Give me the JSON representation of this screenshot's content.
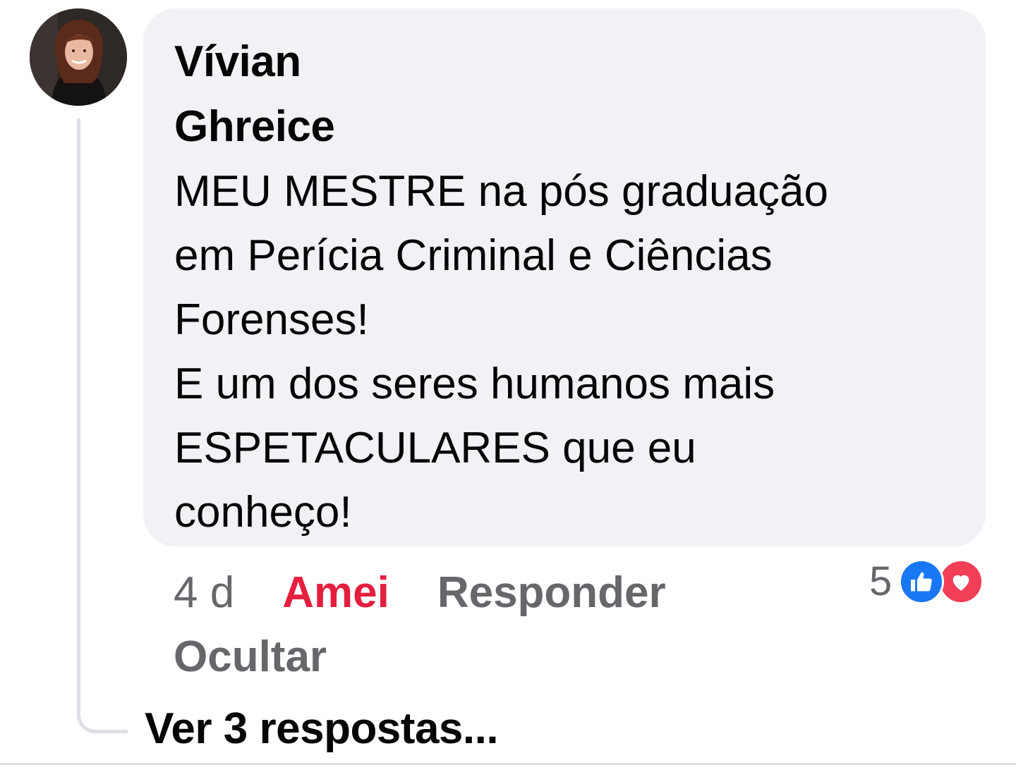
{
  "comment": {
    "author": "Vívian\nGhreice",
    "text": "MEU MESTRE na pós graduação\nem Perícia Criminal e Ciências\nForenses!\nE um dos seres humanos mais\nESPETACULARES que eu\nconheço!",
    "timestamp": "4 d",
    "actions": {
      "love": "Amei",
      "reply": "Responder",
      "hide": "Ocultar"
    },
    "reactions": {
      "count": "5",
      "types": [
        "like-icon",
        "heart-icon"
      ]
    },
    "view_replies": "Ver 3 respostas..."
  },
  "colors": {
    "bubble": "#f0f2f5",
    "love": "#e41e3f",
    "secondary_text": "#65676b",
    "like_blue": "#1877f2",
    "heart_red": "#f33e58"
  }
}
